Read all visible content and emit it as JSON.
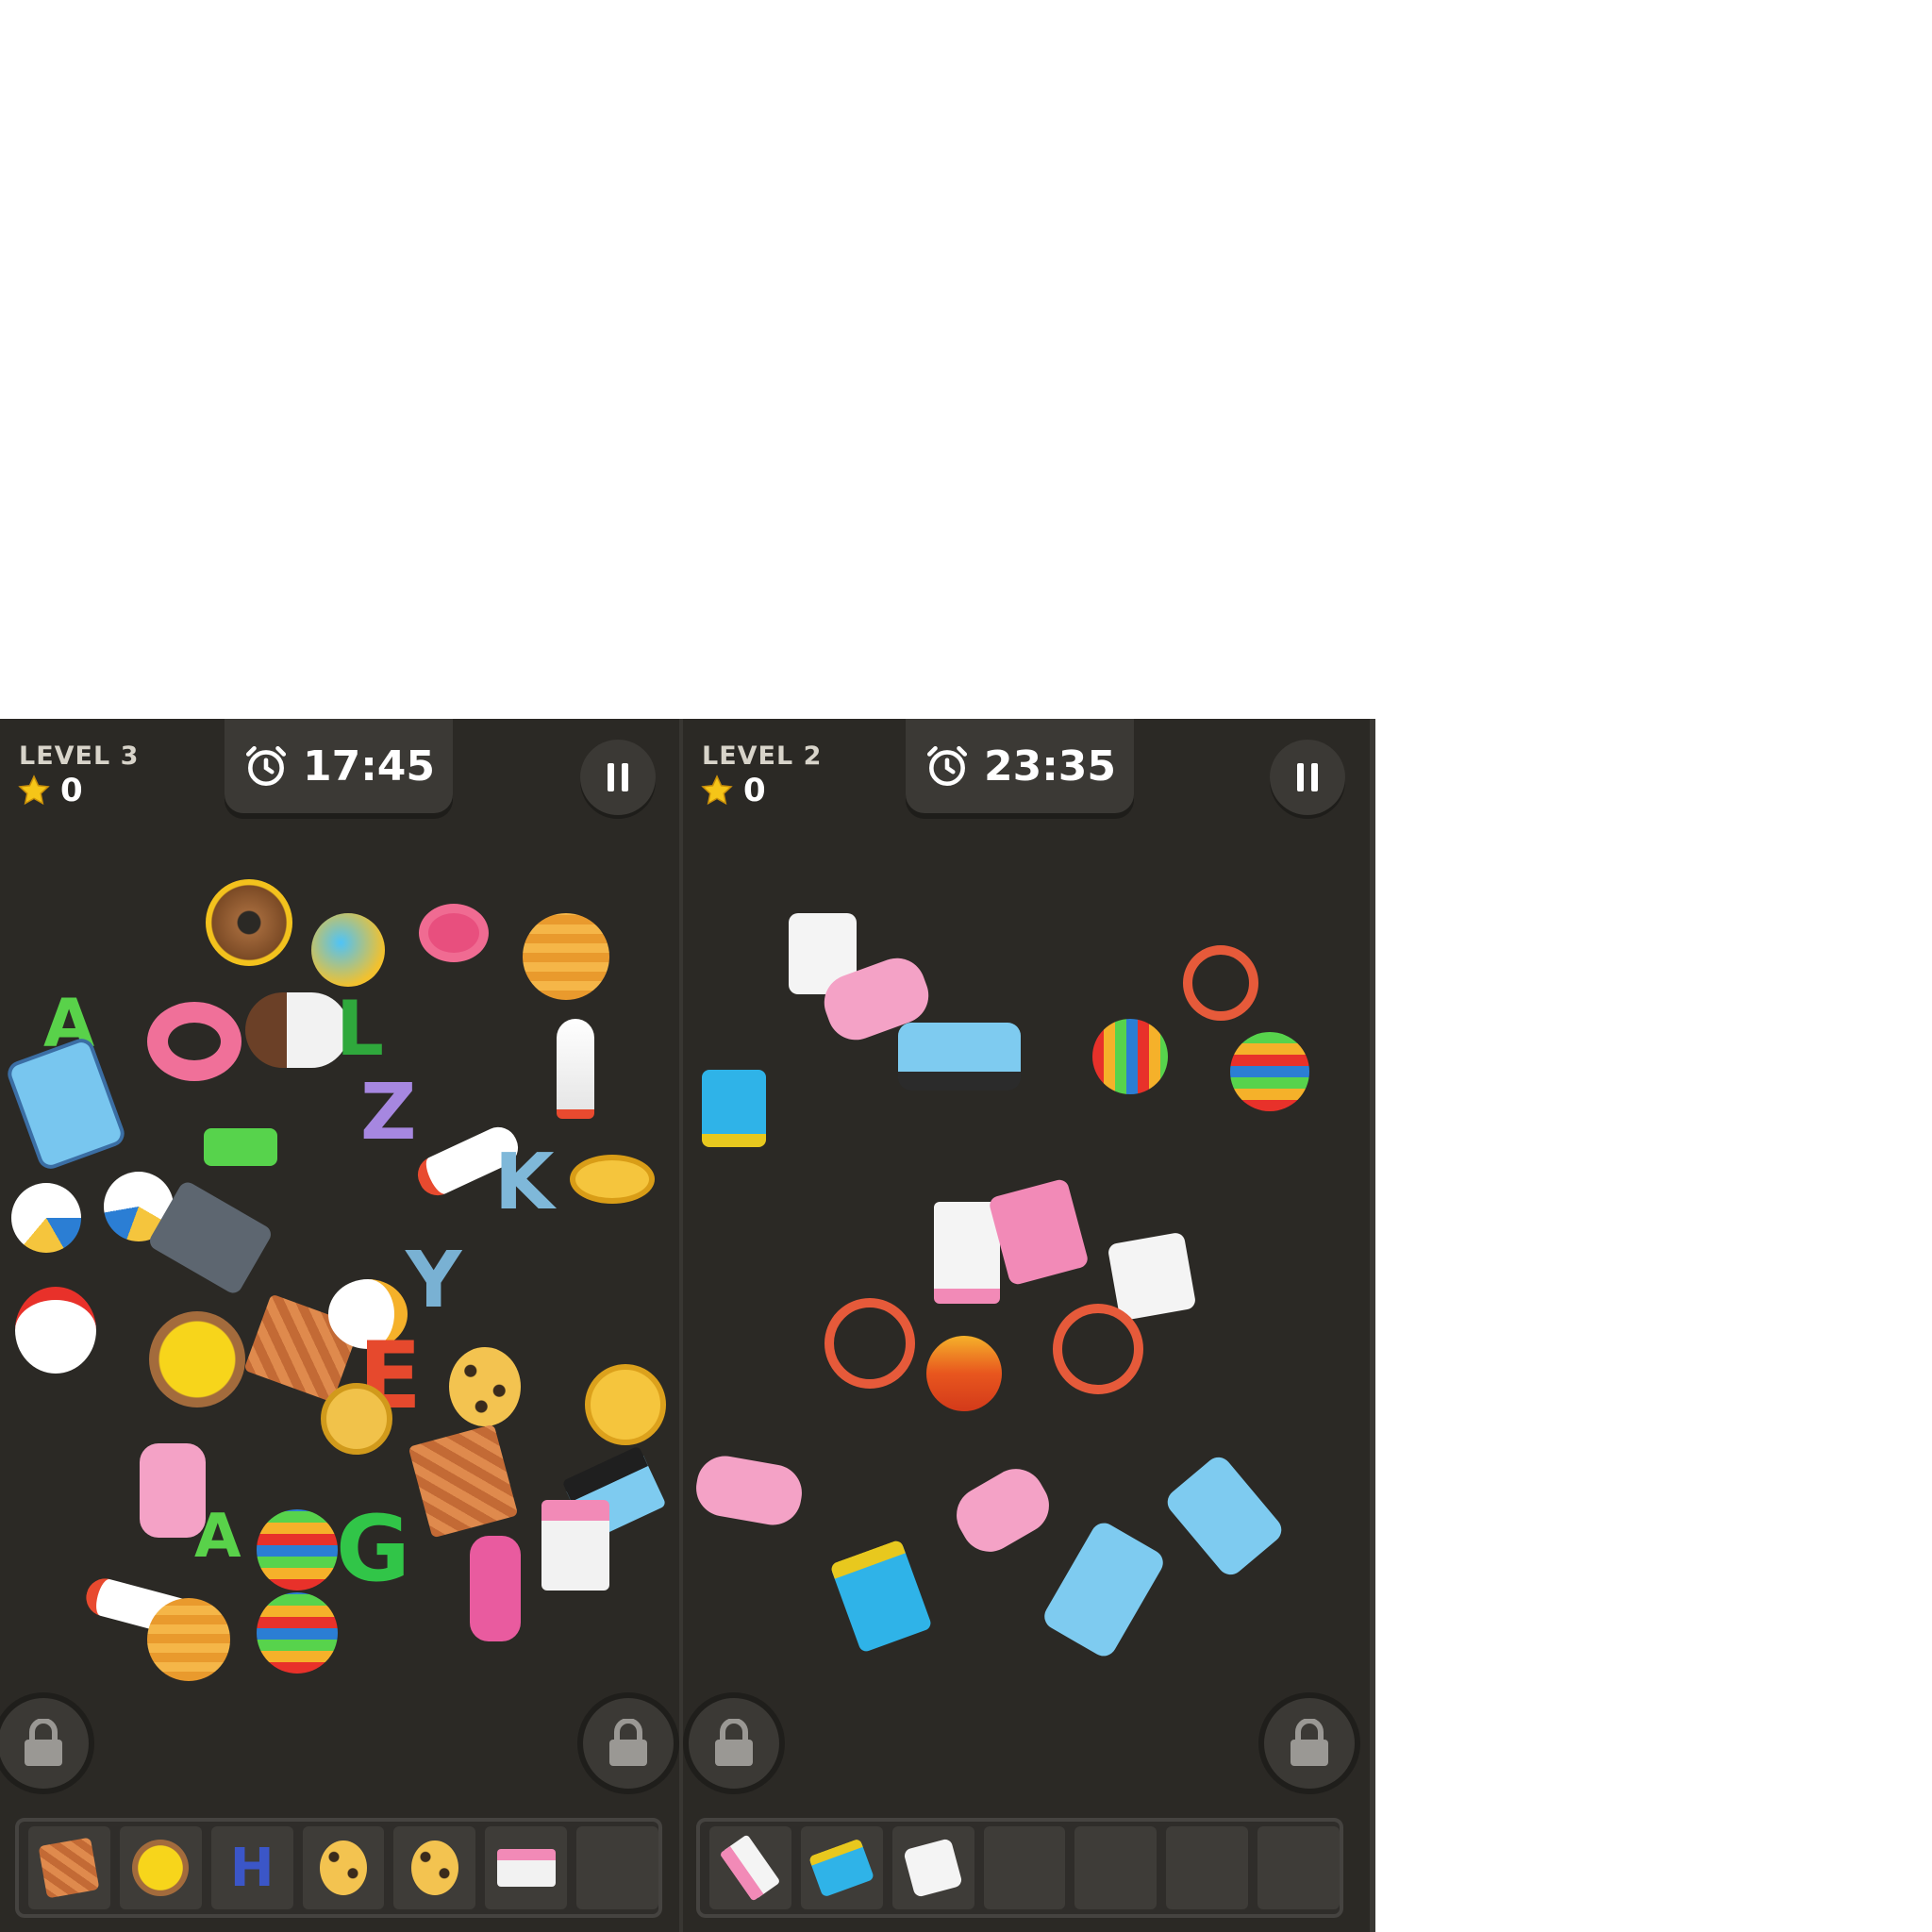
{
  "panels": [
    {
      "level_label": "LEVEL 3",
      "score": "0",
      "timer": "17:45",
      "tray": {
        "slots_total": 7,
        "items": [
          "waffle-cone-block",
          "yellow-spool",
          "letter-H",
          "leopard-egg",
          "leopard-egg",
          "pink-radio"
        ],
        "letter_H": "H"
      },
      "board": {
        "letters": [
          "A",
          "O",
          "L",
          "Z",
          "K",
          "E",
          "Y",
          "G"
        ]
      }
    },
    {
      "level_label": "LEVEL 2",
      "score": "0",
      "timer": "23:35",
      "tray": {
        "slots_total": 7,
        "items": [
          "pink-speaker",
          "blue-block-car",
          "white-dice"
        ]
      }
    }
  ],
  "icons": {
    "star": "star-icon",
    "timer": "alarm-clock-icon",
    "pause": "pause-icon",
    "lock": "lock-icon"
  },
  "colors": {
    "background": "#2b2925",
    "hud": "#3b3935",
    "star": "#f5c518"
  }
}
